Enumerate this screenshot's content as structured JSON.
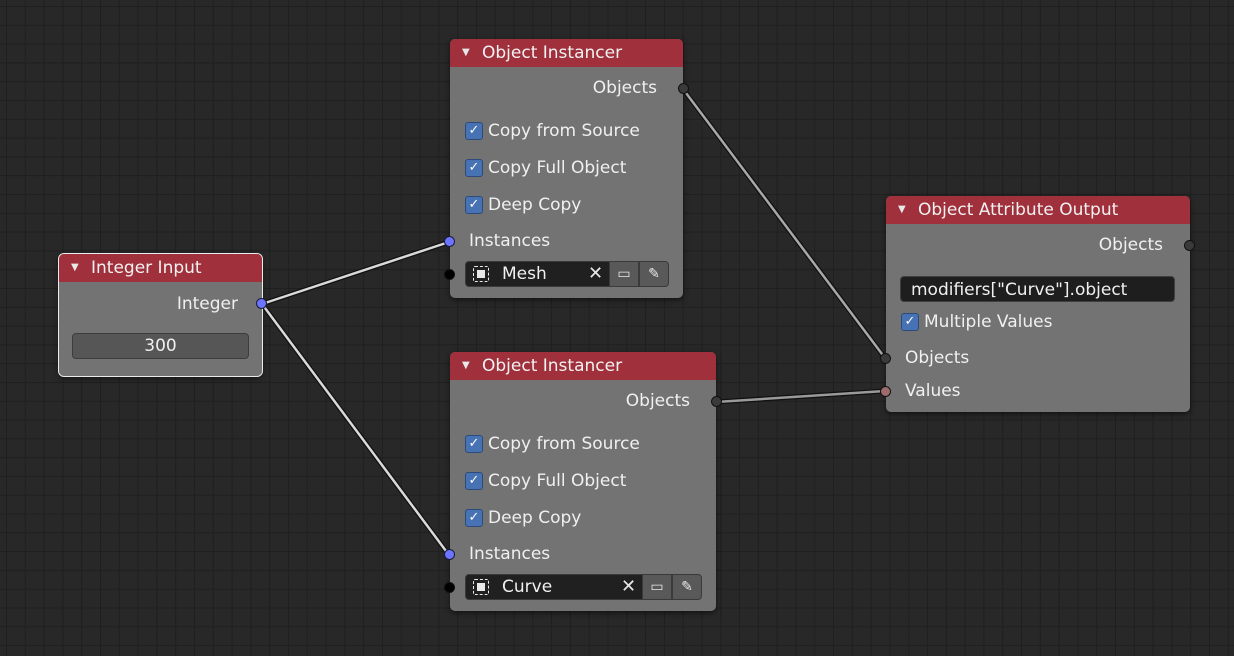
{
  "nodes": {
    "integer_input": {
      "title": "Integer Input",
      "output_label": "Integer",
      "value": "300"
    },
    "instancer_1": {
      "title": "Object Instancer",
      "output_label": "Objects",
      "options": [
        "Copy from Source",
        "Copy Full Object",
        "Deep Copy"
      ],
      "input_label": "Instances",
      "object": "Mesh"
    },
    "instancer_2": {
      "title": "Object Instancer",
      "output_label": "Objects",
      "options": [
        "Copy from Source",
        "Copy Full Object",
        "Deep Copy"
      ],
      "input_label": "Instances",
      "object": "Curve"
    },
    "attribute_output": {
      "title": "Object Attribute Output",
      "output_label": "Objects",
      "path": "modifiers[\"Curve\"].object",
      "option": "Multiple Values",
      "input_objects_label": "Objects",
      "input_values_label": "Values"
    }
  },
  "icons": {
    "collapse": "triangle-down-icon",
    "checkbox": "checkmark-icon",
    "object": "object-data-icon",
    "clear": "x-icon",
    "display": "monitor-icon",
    "eyedropper": "eyedropper-icon"
  },
  "colors": {
    "header": "#a0303c",
    "node_body": "#737373",
    "checkbox": "#4772b3",
    "socket_integer": "#6b75ff",
    "socket_object": "#3a3a3a",
    "socket_values": "#9e6b6b",
    "link": "#d9d9d9"
  }
}
